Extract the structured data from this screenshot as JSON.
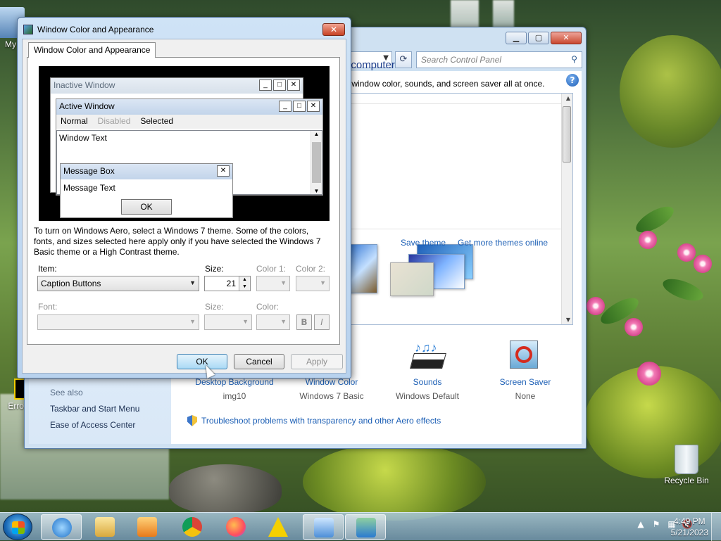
{
  "desktop": {
    "icons": [
      {
        "label": "My",
        "id": "my-computer"
      },
      {
        "label": "Recycle Bin",
        "id": "recycle-bin"
      },
      {
        "label": "Erro Sho",
        "id": "error-shortcut"
      }
    ]
  },
  "control_panel": {
    "search_placeholder": "Search Control Panel",
    "heading": "your computer",
    "subheading": "sound, window color, sounds, and screen saver all at once.",
    "links": {
      "save_theme": "Save theme",
      "get_more": "Get more themes online"
    },
    "bottom_items": [
      {
        "title": "Desktop Background",
        "value": "img10"
      },
      {
        "title": "Window Color",
        "value": "Windows 7 Basic"
      },
      {
        "title": "Sounds",
        "value": "Windows Default"
      },
      {
        "title": "Screen Saver",
        "value": "None"
      }
    ],
    "see_also": {
      "heading": "See also",
      "items": [
        "Taskbar and Start Menu",
        "Ease of Access Center"
      ]
    },
    "troubleshoot": "Troubleshoot problems with transparency and other Aero effects"
  },
  "dialog": {
    "title": "Window Color and Appearance",
    "tab": "Window Color and Appearance",
    "preview": {
      "inactive_title": "Inactive Window",
      "active_title": "Active Window",
      "menu": {
        "normal": "Normal",
        "disabled": "Disabled",
        "selected": "Selected"
      },
      "window_text": "Window Text",
      "msgbox_title": "Message Box",
      "msgbox_text": "Message Text",
      "ok": "OK"
    },
    "description": "To turn on Windows Aero, select a Windows 7 theme.  Some of the colors, fonts, and sizes selected here apply only if you have selected the Windows 7 Basic theme or a High Contrast theme.",
    "labels": {
      "item": "Item:",
      "size": "Size:",
      "color1": "Color 1:",
      "color2": "Color 2:",
      "font": "Font:",
      "size2": "Size:",
      "color": "Color:"
    },
    "item_value": "Caption Buttons",
    "size_value": "21",
    "bold_label": "B",
    "italic_label": "I",
    "buttons": {
      "ok": "OK",
      "cancel": "Cancel",
      "apply": "Apply"
    }
  },
  "taskbar": {
    "time": "4:49 PM",
    "date": "5/21/2023"
  }
}
